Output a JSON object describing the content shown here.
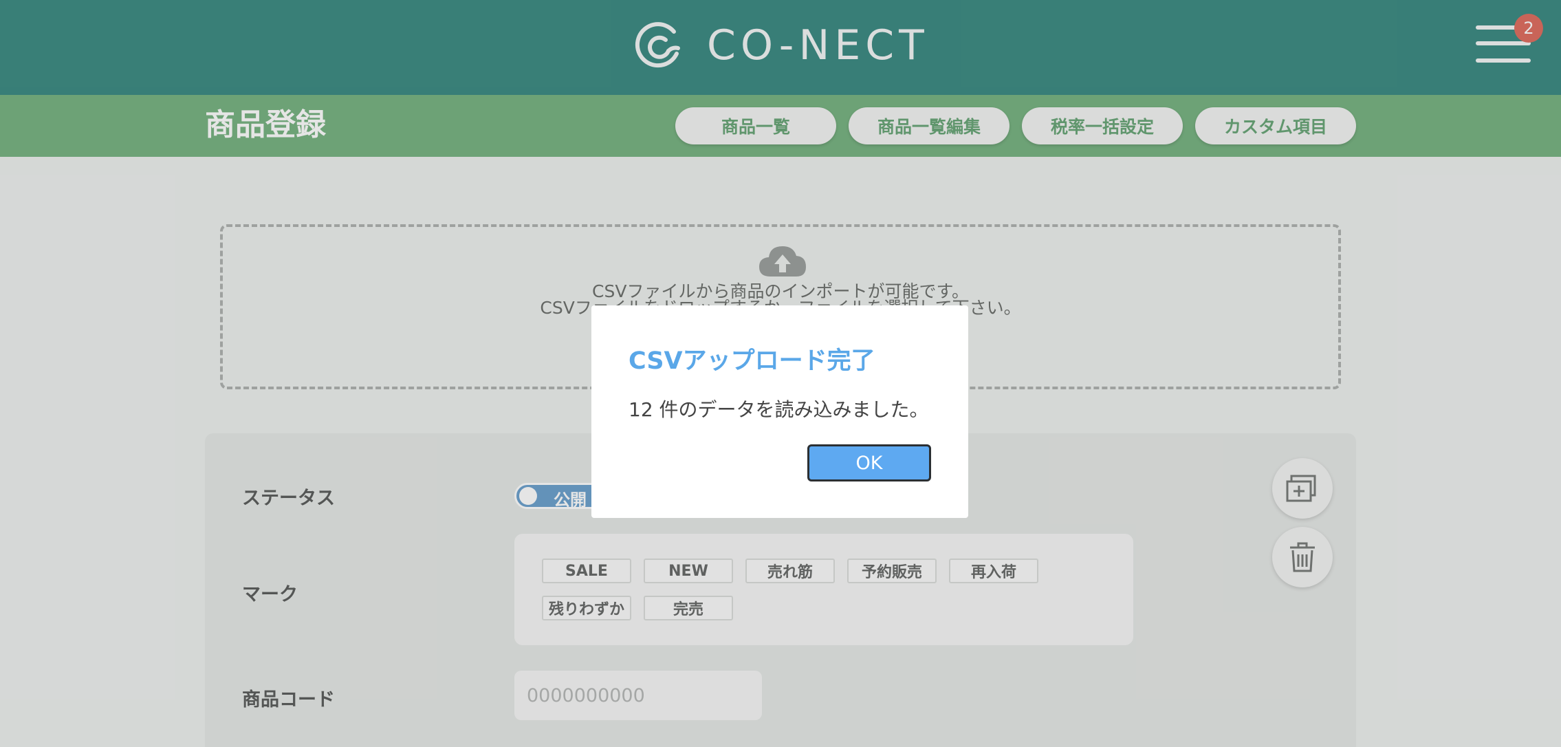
{
  "header": {
    "logo_text": "CO-NECT",
    "menu_badge": "2"
  },
  "subbar": {
    "title": "商品登録",
    "nav": [
      "商品一覧",
      "商品一覧編集",
      "税率一括設定",
      "カスタム項目"
    ]
  },
  "dropzone": {
    "line1": "CSVファイルから商品のインポートが可能です。",
    "line2": "CSVファイルをドロップするか、ファイルを選択して下さい。"
  },
  "form": {
    "status_label": "ステータス",
    "status_value": "公開",
    "mark_label": "マーク",
    "marks": [
      "SALE",
      "NEW",
      "売れ筋",
      "予約販売",
      "再入荷",
      "残りわずか",
      "完売"
    ],
    "code_label": "商品コード",
    "code_placeholder": "0000000000"
  },
  "modal": {
    "title": "CSVアップロード完了",
    "message": "12 件のデータを読み込みました。",
    "ok_label": "OK"
  },
  "colors": {
    "header": "#3f8d85",
    "subbar": "#7ab584",
    "accent_blue": "#5ea9f1"
  }
}
